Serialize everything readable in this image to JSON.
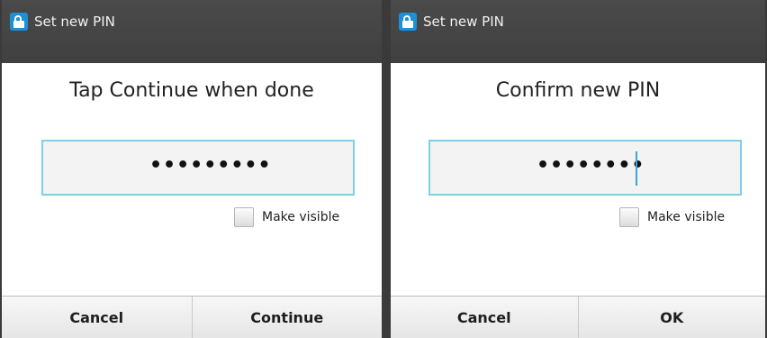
{
  "left_dialog": {
    "title": "Set new PIN",
    "heading": "Tap Continue when done",
    "pin_mask": "•••••••••",
    "make_visible_label": "Make visible",
    "buttons": {
      "cancel": "Cancel",
      "confirm": "Continue"
    },
    "icon": "lock-icon"
  },
  "right_dialog": {
    "title": "Set new PIN",
    "heading": "Confirm new PIN",
    "pin_mask": "••••••••",
    "make_visible_label": "Make visible",
    "buttons": {
      "cancel": "Cancel",
      "confirm": "OK"
    },
    "icon": "lock-icon"
  },
  "colors": {
    "titlebar": "#444444",
    "lock_icon_bg": "#1f8fd6",
    "field_border": "#7fcfe6",
    "cursor": "#3aa6d3"
  }
}
